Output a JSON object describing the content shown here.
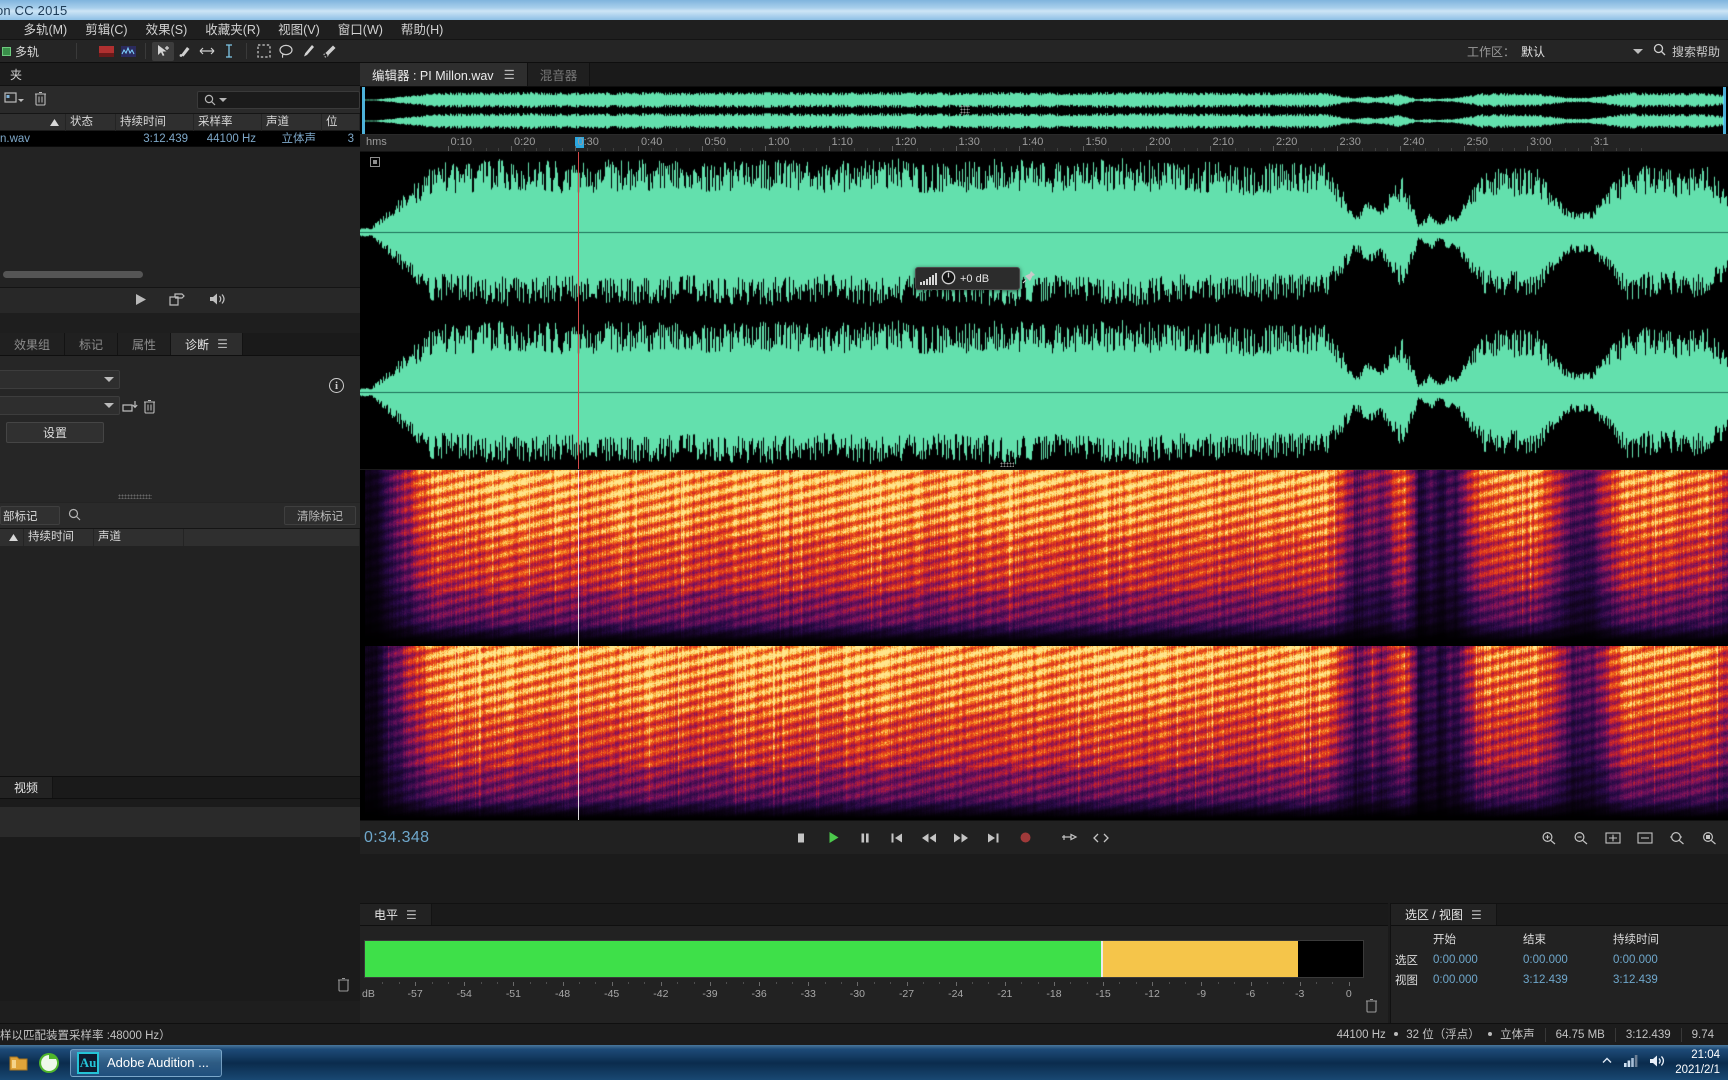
{
  "window": {
    "title": "on CC 2015"
  },
  "menu": {
    "items": [
      {
        "label": "多轨(M)"
      },
      {
        "label": "剪辑(C)"
      },
      {
        "label": "效果(S)"
      },
      {
        "label": "收藏夹(R)"
      },
      {
        "label": "视图(V)"
      },
      {
        "label": "窗口(W)"
      },
      {
        "label": "帮助(H)"
      }
    ]
  },
  "toolbar": {
    "mode_label": "多轨",
    "workspace_label": "工作区：",
    "workspace_value": "默认",
    "search_help": "搜索帮助",
    "tools": [
      "waveform-view-icon",
      "spectral-view-icon",
      "move-tool-icon",
      "slip-tool-icon",
      "time-selection-icon",
      "razor-icon",
      "marquee-selection-icon",
      "lasso-selection-icon",
      "paintbrush-selection-icon",
      "spot-healing-brush-icon"
    ]
  },
  "files_panel": {
    "tab_label": "夹",
    "search_placeholder": "",
    "columns": [
      "",
      "状态",
      "持续时间",
      "采样率",
      "声道",
      "位"
    ],
    "rows": [
      {
        "name": "n.wav",
        "status": "",
        "duration": "3:12.439",
        "samplerate": "44100 Hz",
        "channels": "立体声",
        "bits": "3"
      }
    ]
  },
  "diagnostics_panel": {
    "tabs": [
      "效果组",
      "标记",
      "属性",
      "诊断"
    ],
    "active_tab": "诊断",
    "settings_button": "设置",
    "effect_dropdown": "",
    "preset_dropdown": ""
  },
  "markers_panel": {
    "filter_label": "部标记",
    "clear_button": "清除标记",
    "columns": [
      "持续时间",
      "声道"
    ]
  },
  "video_panel": {
    "tab_label": "视频"
  },
  "editor": {
    "tabs": [
      {
        "label": "编辑器 : PI Millon.wav",
        "active": true
      },
      {
        "label": "混音器",
        "active": false
      }
    ],
    "ruler": {
      "origin_label": "hms",
      "labels": [
        "0:10",
        "0:20",
        "0:30",
        "0:40",
        "0:50",
        "1:00",
        "1:10",
        "1:20",
        "1:30",
        "1:40",
        "1:50",
        "2:00",
        "2:10",
        "2:20",
        "2:30",
        "2:40",
        "2:50",
        "3:00",
        "3:1"
      ]
    },
    "hud": {
      "gain": "+0 dB"
    },
    "playhead_time": "0:34.348",
    "transport": [
      "stop-button",
      "play-button",
      "pause-button",
      "skip-to-start-button",
      "rewind-button",
      "fast-forward-button",
      "skip-to-end-button",
      "record-button",
      "loop-playback-button",
      "metronome-button"
    ],
    "zoom_tools": [
      "zoom-in-amplitude-icon",
      "zoom-out-amplitude-icon",
      "zoom-in-time-icon",
      "zoom-out-time-icon",
      "zoom-out-full-icon",
      "zoom-to-selection-icon"
    ]
  },
  "levels_panel": {
    "tab_label": "电平",
    "db_unit": "dB",
    "scale_labels": [
      "-57",
      "-54",
      "-51",
      "-48",
      "-45",
      "-42",
      "-39",
      "-36",
      "-33",
      "-30",
      "-27",
      "-24",
      "-21",
      "-18",
      "-15",
      "-12",
      "-9",
      "-6",
      "-3",
      "0"
    ],
    "meter_green_pct": 73.8,
    "meter_yellow_pct": 93.5,
    "colors": {
      "green": "#3ee049",
      "yellow": "#f5c54a",
      "peak": "#ebebeb"
    }
  },
  "selection_view_panel": {
    "tab_label": "选区 / 视图",
    "columns": [
      "",
      "开始",
      "结束",
      "持续时间"
    ],
    "rows": [
      {
        "label": "选区",
        "start": "0:00.000",
        "end": "0:00.000",
        "duration": "0:00.000"
      },
      {
        "label": "视图",
        "start": "0:00.000",
        "end": "3:12.439",
        "duration": "3:12.439"
      }
    ]
  },
  "statusbar": {
    "left_text": "样以匹配装置采样率 :48000 Hz）",
    "samplerate": "44100 Hz",
    "bitdepth": "32 位（浮点）",
    "channels": "立体声",
    "filesize": "64.75 MB",
    "duration": "3:12.439",
    "free_space": "9.74"
  },
  "taskbar": {
    "app_button": "Adobe Audition ...",
    "app_badge": "Au",
    "clock_time": "21:04",
    "clock_date": "2021/2/1"
  },
  "colors": {
    "waveform": "#63e0ad",
    "playhead": "#d24848",
    "accent_blue": "#6fa8cc",
    "panel_bg": "#232323",
    "window_bg": "#1b1b1b"
  }
}
